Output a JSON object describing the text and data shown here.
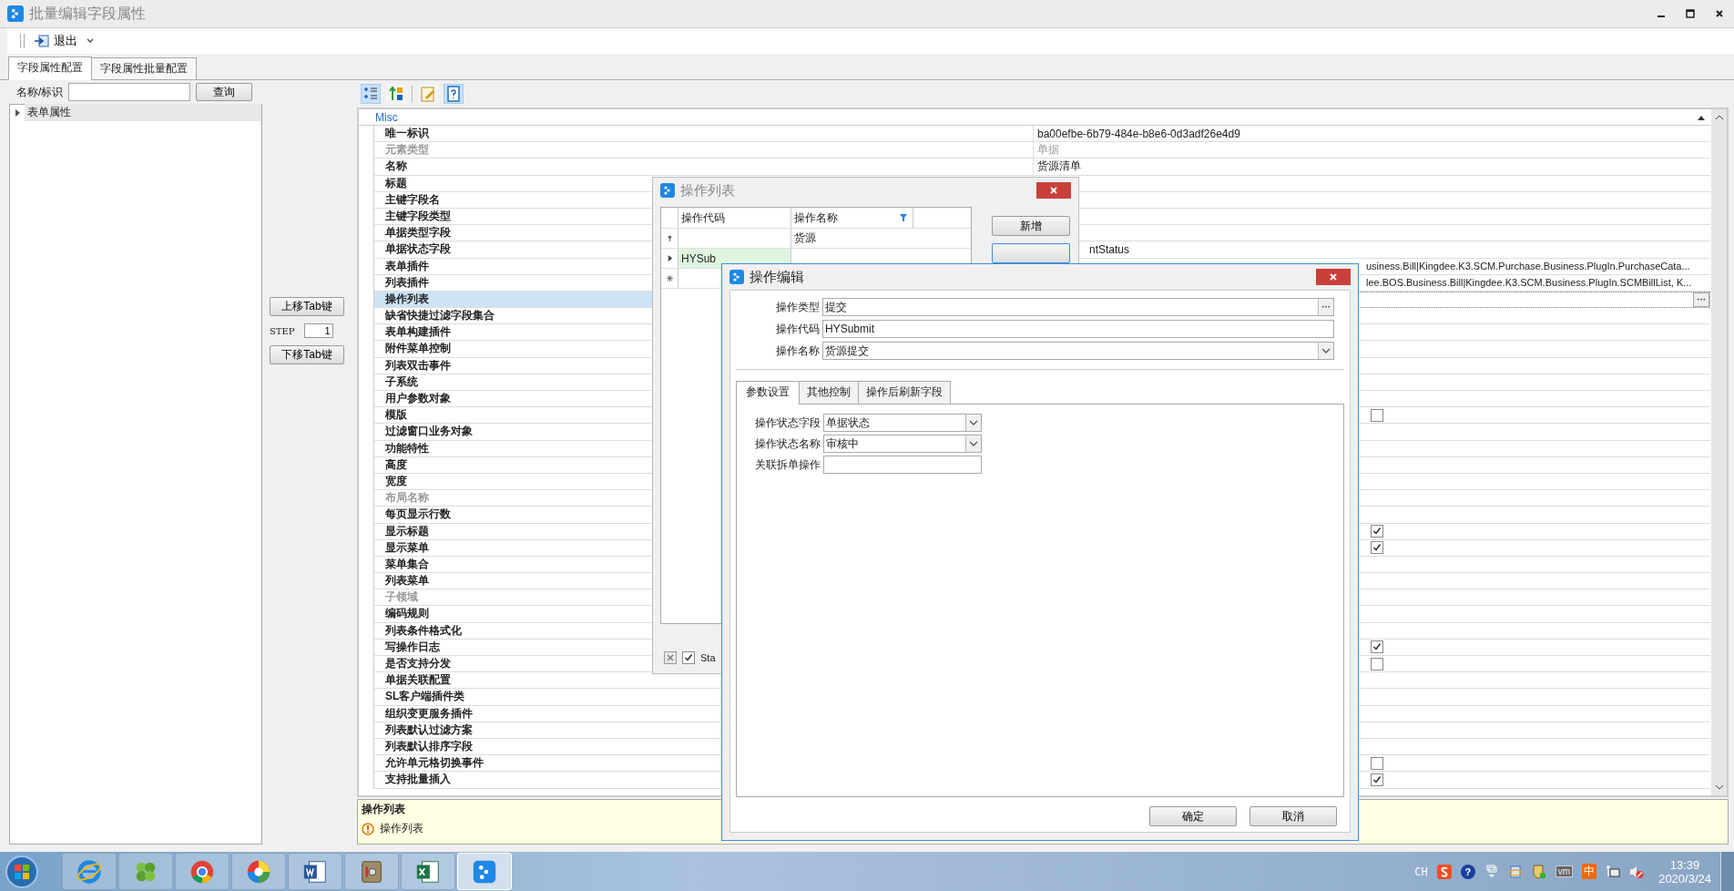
{
  "window": {
    "title": "批量编辑字段属性"
  },
  "toolbar": {
    "exit_label": "退出"
  },
  "tabs": [
    {
      "label": "字段属性配置",
      "selected": true
    },
    {
      "label": "字段属性批量配置",
      "selected": false
    }
  ],
  "search": {
    "label": "名称/标识",
    "button": "查询"
  },
  "tree": [
    {
      "label": "表单属性",
      "expanded": false,
      "selected": true
    }
  ],
  "tab_order": {
    "up_button": "上移Tab键",
    "step_label": "STEP",
    "step_value": "1",
    "down_button": "下移Tab键"
  },
  "grid_toolbar": [
    {
      "kind": "categorized",
      "selected": true
    },
    {
      "kind": "alphabetical",
      "selected": false
    },
    {
      "kind": "property-pages",
      "selected": false
    },
    {
      "kind": "help",
      "selected": true
    }
  ],
  "property_grid": {
    "category": "Misc",
    "rows": [
      {
        "name": "唯一标识",
        "kind": "text",
        "value": "ba00efbe-6b79-484e-b8e6-0d3adf26e4d9",
        "disabled": false,
        "selected": false
      },
      {
        "name": "元素类型",
        "kind": "text",
        "value": "单据",
        "disabled": true,
        "selected": false
      },
      {
        "name": "名称",
        "kind": "text",
        "value": "货源清单",
        "disabled": false,
        "selected": false
      },
      {
        "name": "标题",
        "kind": "empty",
        "disabled": false,
        "selected": false
      },
      {
        "name": "主键字段名",
        "kind": "empty",
        "disabled": false,
        "selected": false
      },
      {
        "name": "主键字段类型",
        "kind": "empty",
        "disabled": false,
        "selected": false
      },
      {
        "name": "单据类型字段",
        "kind": "empty",
        "disabled": false,
        "selected": false
      },
      {
        "name": "单据状态字段",
        "kind": "partial",
        "value": "ntStatus",
        "disabled": false,
        "selected": false
      },
      {
        "name": "表单插件",
        "kind": "tail",
        "value": "usiness.Bill|Kingdee.K3.SCM.Purchase.Business.PlugIn.PurchaseCata...",
        "disabled": false,
        "selected": false
      },
      {
        "name": "列表插件",
        "kind": "tail",
        "value": "lee.BOS.Business.Bill|Kingdee.K3.SCM.Business.PlugIn.SCMBillList, K...",
        "disabled": false,
        "selected": false
      },
      {
        "name": "操作列表",
        "kind": "lookup",
        "disabled": false,
        "selected": true
      },
      {
        "name": "缺省快捷过滤字段集合",
        "kind": "empty",
        "disabled": false,
        "selected": false
      },
      {
        "name": "表单构建插件",
        "kind": "empty",
        "disabled": false,
        "selected": false
      },
      {
        "name": "附件菜单控制",
        "kind": "empty",
        "disabled": false,
        "selected": false
      },
      {
        "name": "列表双击事件",
        "kind": "empty",
        "disabled": false,
        "selected": false
      },
      {
        "name": "子系统",
        "kind": "empty",
        "disabled": false,
        "selected": false
      },
      {
        "name": "用户参数对象",
        "kind": "empty",
        "disabled": false,
        "selected": false
      },
      {
        "name": "模版",
        "kind": "check",
        "checked": false,
        "disabled": false,
        "selected": false
      },
      {
        "name": "过滤窗口业务对象",
        "kind": "empty",
        "disabled": false,
        "selected": false
      },
      {
        "name": "功能特性",
        "kind": "empty",
        "disabled": false,
        "selected": false
      },
      {
        "name": "高度",
        "kind": "empty",
        "disabled": false,
        "selected": false
      },
      {
        "name": "宽度",
        "kind": "empty",
        "disabled": false,
        "selected": false
      },
      {
        "name": "布局名称",
        "kind": "empty",
        "disabled": true,
        "selected": false
      },
      {
        "name": "每页显示行数",
        "kind": "empty",
        "disabled": false,
        "selected": false
      },
      {
        "name": "显示标题",
        "kind": "check",
        "checked": true,
        "disabled": false,
        "selected": false
      },
      {
        "name": "显示菜单",
        "kind": "check",
        "checked": true,
        "disabled": false,
        "selected": false
      },
      {
        "name": "菜单集合",
        "kind": "empty",
        "disabled": false,
        "selected": false
      },
      {
        "name": "列表菜单",
        "kind": "empty",
        "disabled": false,
        "selected": false
      },
      {
        "name": "子领域",
        "kind": "empty",
        "disabled": true,
        "selected": false
      },
      {
        "name": "编码规则",
        "kind": "empty",
        "disabled": false,
        "selected": false
      },
      {
        "name": "列表条件格式化",
        "kind": "empty",
        "disabled": false,
        "selected": false
      },
      {
        "name": "写操作日志",
        "kind": "check",
        "checked": true,
        "disabled": false,
        "selected": false
      },
      {
        "name": "是否支持分发",
        "kind": "check",
        "checked": false,
        "disabled": false,
        "selected": false
      },
      {
        "name": "单据关联配置",
        "kind": "empty",
        "disabled": false,
        "selected": false
      },
      {
        "name": "SL客户端插件类",
        "kind": "empty",
        "disabled": false,
        "selected": false
      },
      {
        "name": "组织变更服务插件",
        "kind": "empty",
        "disabled": false,
        "selected": false
      },
      {
        "name": "列表默认过滤方案",
        "kind": "empty",
        "disabled": false,
        "selected": false
      },
      {
        "name": "列表默认排序字段",
        "kind": "empty",
        "disabled": false,
        "selected": false
      },
      {
        "name": "允许单元格切换事件",
        "kind": "check",
        "checked": false,
        "disabled": false,
        "selected": false
      },
      {
        "name": "支持批量插入",
        "kind": "check",
        "checked": true,
        "disabled": false,
        "selected": false
      }
    ]
  },
  "description": {
    "title": "操作列表",
    "text": "操作列表"
  },
  "operation_list_dialog": {
    "title": "操作列表",
    "columns": [
      "操作代码",
      "操作名称"
    ],
    "rows": [
      {
        "kind": "filter",
        "name": "货源",
        "selected": false
      },
      {
        "kind": "current",
        "code": "HYSub",
        "selected": true
      },
      {
        "kind": "new",
        "selected": false
      }
    ],
    "buttons": [
      "新增"
    ],
    "footer_checkbox": {
      "label": "Sta",
      "checked": true
    }
  },
  "operation_edit_dialog": {
    "title": "操作编辑",
    "fields": [
      {
        "label": "操作类型",
        "value": "提交",
        "kind": "lookup"
      },
      {
        "label": "操作代码",
        "value": "HYSubmit",
        "kind": "text"
      },
      {
        "label": "操作名称",
        "value": "货源提交",
        "kind": "select"
      }
    ],
    "tabs": [
      {
        "label": "参数设置",
        "selected": true
      },
      {
        "label": "其他控制",
        "selected": false
      },
      {
        "label": "操作后刷新字段",
        "selected": false
      }
    ],
    "params": [
      {
        "label": "操作状态字段",
        "value": "单据状态",
        "kind": "select"
      },
      {
        "label": "操作状态名称",
        "value": "审核中",
        "kind": "select"
      },
      {
        "label": "关联拆单操作",
        "kind": "text"
      }
    ],
    "buttons": [
      "确定",
      "取消"
    ]
  },
  "taskbar": {
    "apps": [
      {
        "kind": "ie",
        "selected": false
      },
      {
        "kind": "clover",
        "selected": false
      },
      {
        "kind": "chrome",
        "selected": false
      },
      {
        "kind": "wheel",
        "selected": false
      },
      {
        "kind": "word",
        "selected": false
      },
      {
        "kind": "safe",
        "selected": false
      },
      {
        "kind": "excel",
        "selected": false
      },
      {
        "kind": "kingdee",
        "selected": true
      }
    ],
    "tray": [
      {
        "kind": "language",
        "text": "CH"
      },
      {
        "kind": "sogou"
      },
      {
        "kind": "help",
        "text": "?"
      },
      {
        "kind": "expand"
      },
      {
        "kind": "globe"
      },
      {
        "kind": "shield"
      },
      {
        "kind": "vm",
        "text": "vm"
      },
      {
        "kind": "ime",
        "text": "中"
      },
      {
        "kind": "network"
      },
      {
        "kind": "volume-muted"
      }
    ],
    "time": "13:39",
    "date": "2020/3/24"
  }
}
